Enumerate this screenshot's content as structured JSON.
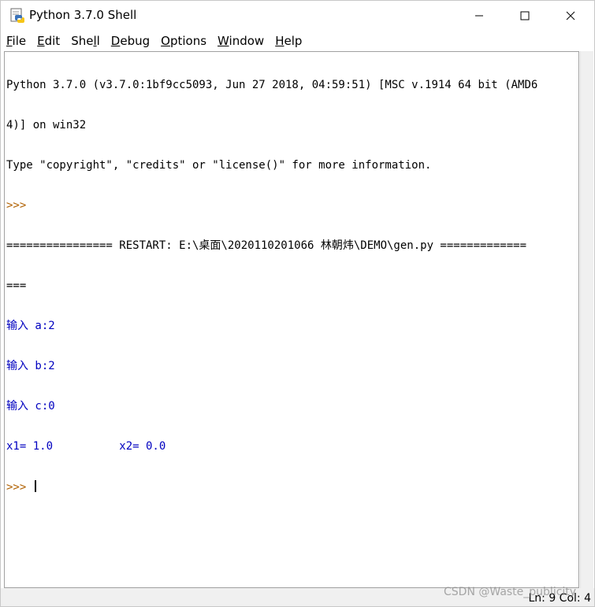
{
  "window": {
    "title": "Python 3.7.0 Shell"
  },
  "menu": [
    {
      "label": "File",
      "mnemonic": "F",
      "rest": "ile"
    },
    {
      "label": "Edit",
      "mnemonic": "E",
      "rest": "dit"
    },
    {
      "label": "Shell",
      "pre": "She",
      "mnemonic": "l",
      "rest": "l"
    },
    {
      "label": "Debug",
      "mnemonic": "D",
      "rest": "ebug"
    },
    {
      "label": "Options",
      "mnemonic": "O",
      "rest": "ptions"
    },
    {
      "label": "Window",
      "mnemonic": "W",
      "rest": "indow"
    },
    {
      "label": "Help",
      "mnemonic": "H",
      "rest": "elp"
    }
  ],
  "shell": {
    "lines": [
      {
        "text": "Python 3.7.0 (v3.7.0:1bf9cc5093, Jun 27 2018, 04:59:51) [MSC v.1914 64 bit (AMD6",
        "kind": "out"
      },
      {
        "text": "4)] on win32",
        "kind": "out"
      },
      {
        "text": "Type \"copyright\", \"credits\" or \"license()\" for more information.",
        "kind": "out"
      },
      {
        "text": ">>> ",
        "kind": "prompt"
      },
      {
        "text": "================ RESTART: E:\\桌面\\2020110201066 林朝炜\\DEMO\\gen.py =============",
        "kind": "out"
      },
      {
        "text": "===",
        "kind": "out"
      },
      {
        "text": "输入 a:2",
        "kind": "blue"
      },
      {
        "text": "输入 b:2",
        "kind": "blue"
      },
      {
        "text": "输入 c:0",
        "kind": "blue"
      },
      {
        "text": "x1= 1.0          x2= 0.0",
        "kind": "blue"
      },
      {
        "text": ">>> ",
        "kind": "prompt"
      }
    ]
  },
  "status": {
    "text": "Ln: 9   Col: 4"
  },
  "watermark": "CSDN @Waste_publicity",
  "icons": {
    "app": "python-idle-icon",
    "minimize": "minimize-icon",
    "maximize": "maximize-icon",
    "close": "close-icon"
  }
}
